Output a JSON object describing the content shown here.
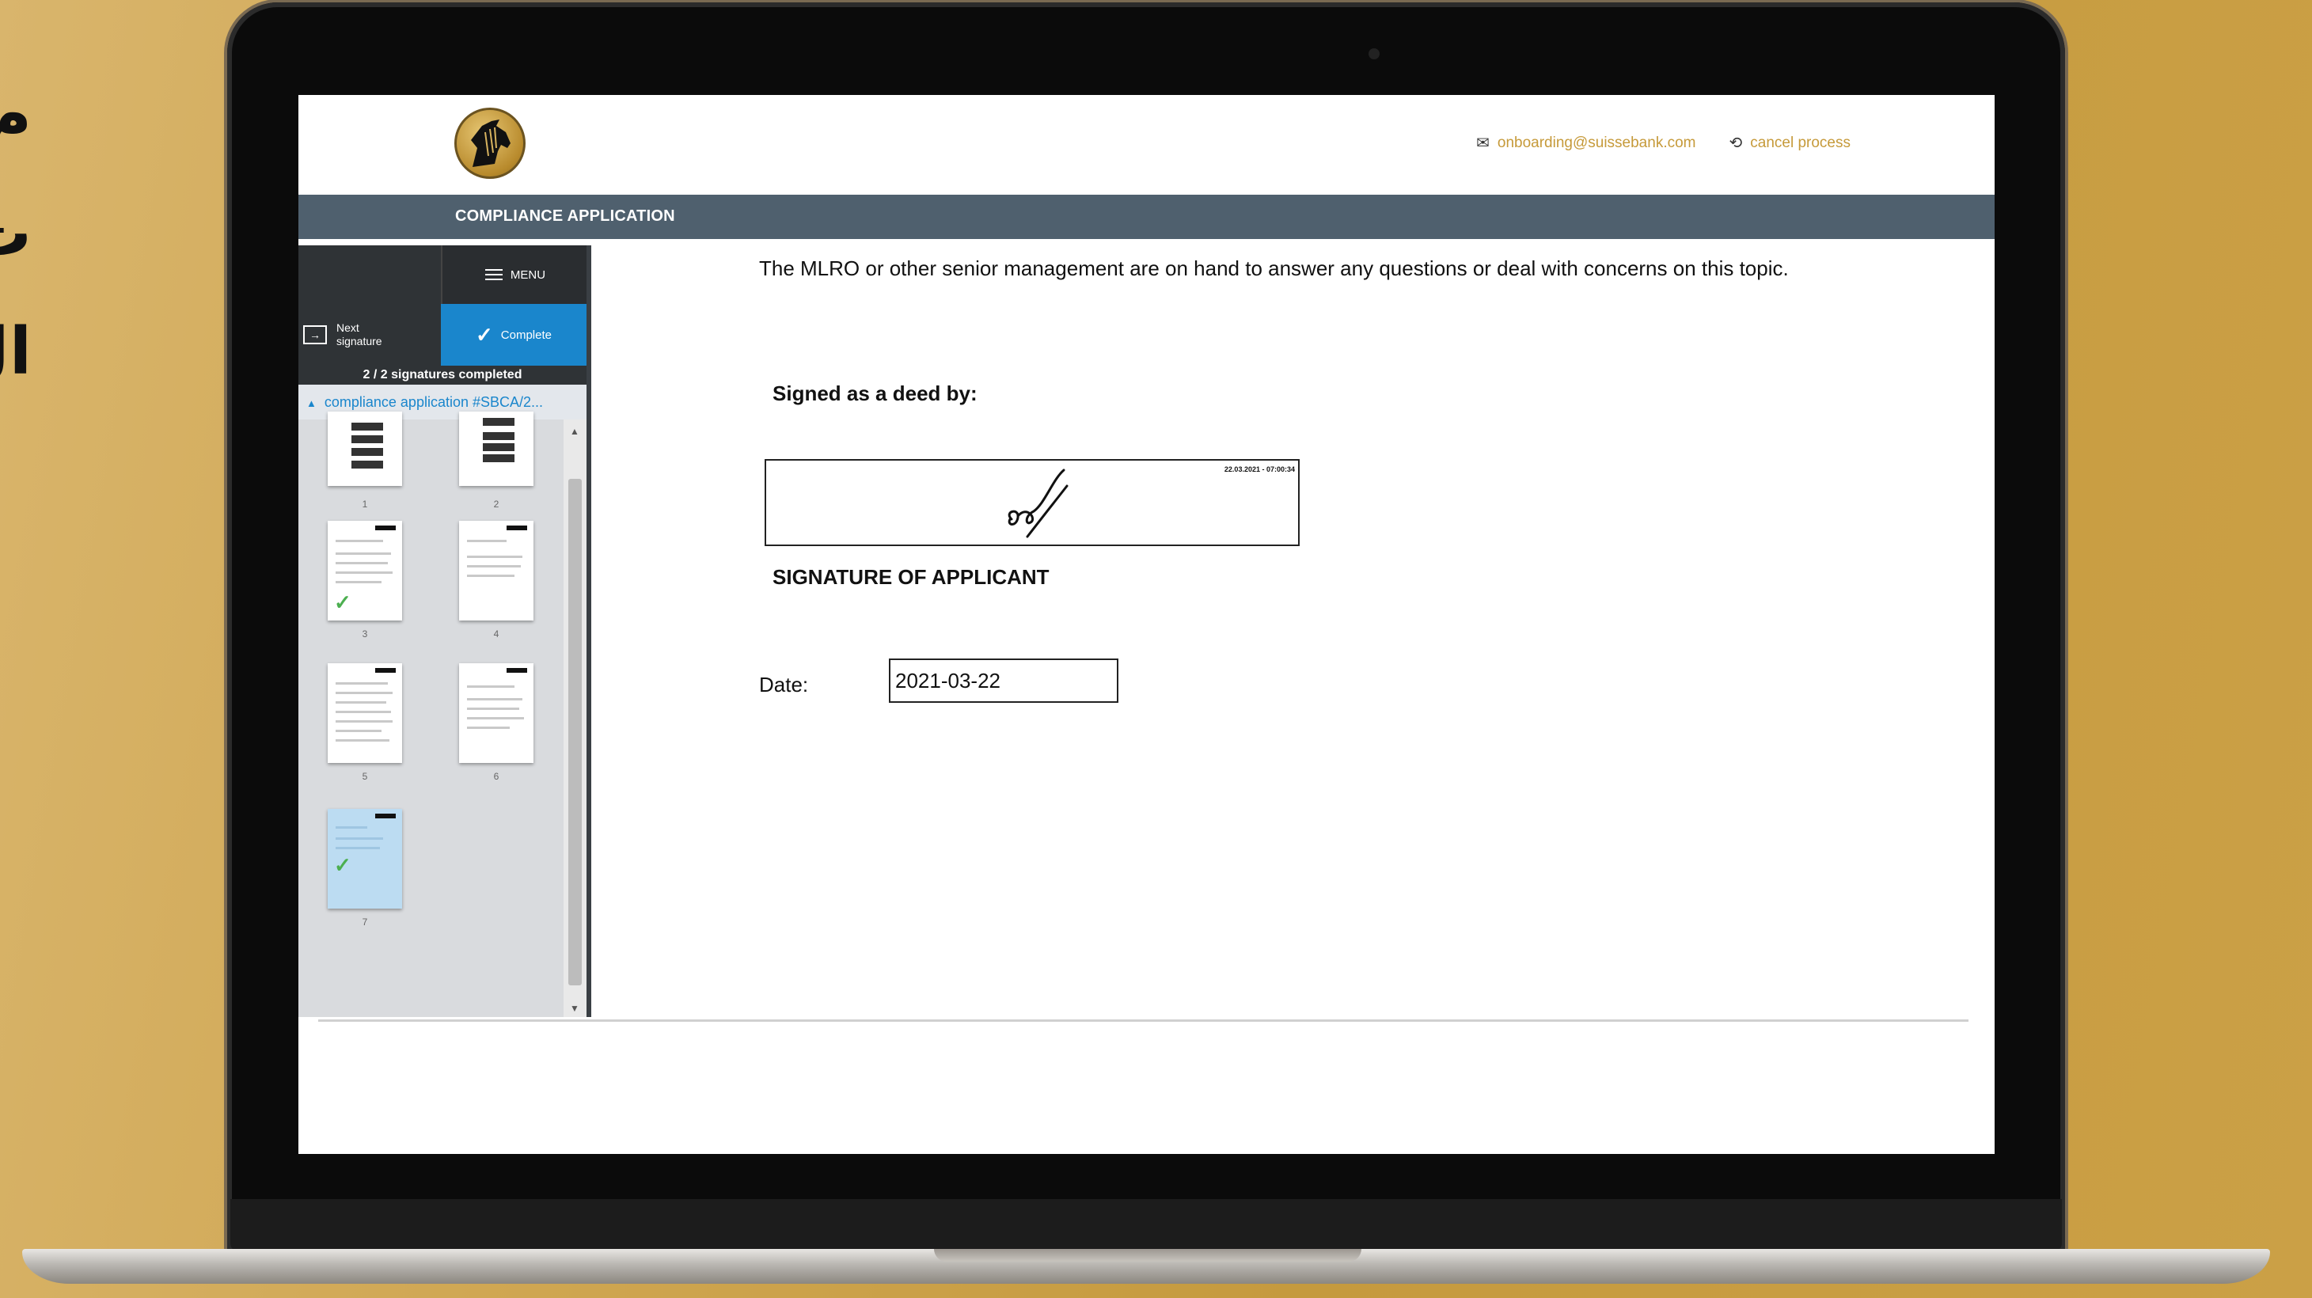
{
  "side_text": [
    "م",
    "ت",
    "ال"
  ],
  "header": {
    "email": "onboarding@suissebank.com",
    "cancel": "cancel process"
  },
  "title_bar": "COMPLIANCE APPLICATION",
  "sidebar": {
    "menu": "MENU",
    "next_line1": "Next",
    "next_line2": "signature",
    "complete": "Complete",
    "status": "2 / 2 signatures completed",
    "document": "compliance application #SBCA/2...",
    "pages": [
      "1",
      "2",
      "3",
      "4",
      "5",
      "6",
      "7"
    ]
  },
  "document": {
    "intro": "The MLRO or other senior management are on hand to answer any questions or deal with concerns on this topic.",
    "signed_label": "Signed as a deed by:",
    "signature_timestamp": "22.03.2021 - 07:00:34",
    "signature_caption": "SIGNATURE OF APPLICANT",
    "date_label": "Date:",
    "date_value": "2021-03-22"
  },
  "colors": {
    "accent": "#1a86cc",
    "gold_link": "#c69a3a",
    "title_bar": "#4f606e"
  }
}
